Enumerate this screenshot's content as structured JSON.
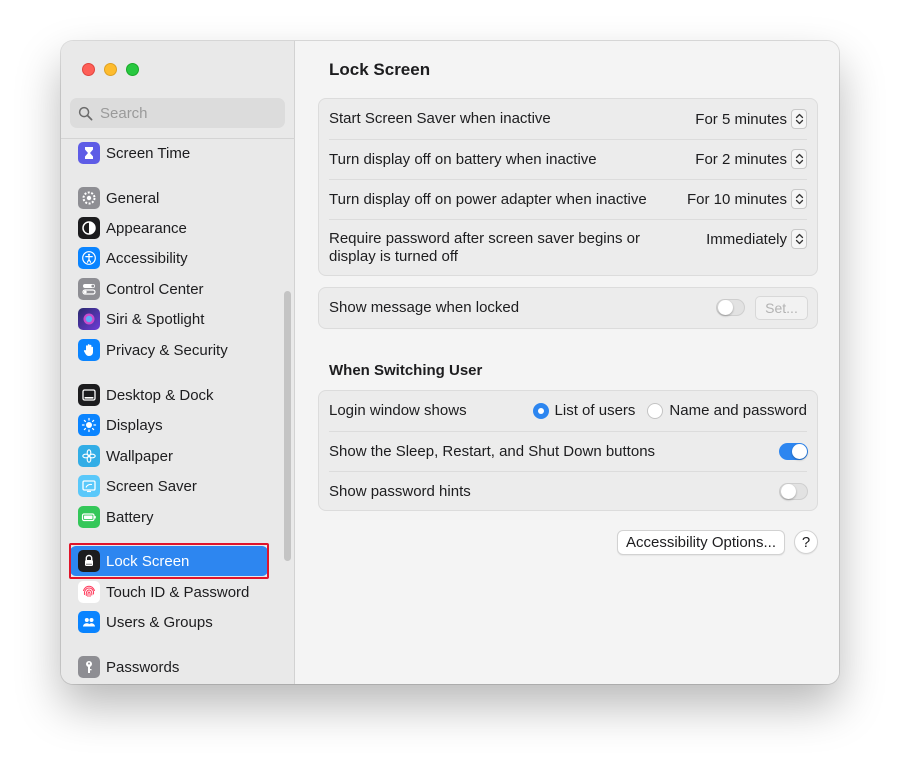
{
  "window": {
    "title": "Lock Screen"
  },
  "search": {
    "placeholder": "Search"
  },
  "sidebar": {
    "items": [
      {
        "label": "Screen Time",
        "icon": "hourglass-icon",
        "color": "#5e5ce6"
      },
      {
        "label": "General",
        "icon": "gear-icon",
        "color": "#8e8e93"
      },
      {
        "label": "Appearance",
        "icon": "appearance-icon",
        "color": "#1c1c1e"
      },
      {
        "label": "Accessibility",
        "icon": "accessibility-icon",
        "color": "#0a84ff"
      },
      {
        "label": "Control Center",
        "icon": "toggles-icon",
        "color": "#8e8e93"
      },
      {
        "label": "Siri & Spotlight",
        "icon": "siri-icon",
        "color": "#6e3bd8"
      },
      {
        "label": "Privacy & Security",
        "icon": "hand-icon",
        "color": "#0a84ff"
      },
      {
        "label": "Desktop & Dock",
        "icon": "dock-icon",
        "color": "#1c1c1e"
      },
      {
        "label": "Displays",
        "icon": "sun-icon",
        "color": "#0a84ff"
      },
      {
        "label": "Wallpaper",
        "icon": "flower-icon",
        "color": "#32ade6"
      },
      {
        "label": "Screen Saver",
        "icon": "screensaver-icon",
        "color": "#5ac8fa"
      },
      {
        "label": "Battery",
        "icon": "battery-icon",
        "color": "#34c759"
      },
      {
        "label": "Lock Screen",
        "icon": "lock-icon",
        "color": "#1c1c1e",
        "selected": true
      },
      {
        "label": "Touch ID & Password",
        "icon": "fingerprint-icon",
        "color": "#ff3b5c"
      },
      {
        "label": "Users & Groups",
        "icon": "users-icon",
        "color": "#0a84ff"
      },
      {
        "label": "Passwords",
        "icon": "key-icon",
        "color": "#8e8e93"
      }
    ]
  },
  "lock_settings": {
    "rows": [
      {
        "label": "Start Screen Saver when inactive",
        "value": "For 5 minutes"
      },
      {
        "label": "Turn display off on battery when inactive",
        "value": "For 2 minutes"
      },
      {
        "label": "Turn display off on power adapter when inactive",
        "value": "For 10 minutes"
      },
      {
        "label_line1": "Require password after screen saver begins or",
        "label_line2": "display is turned off",
        "value": "Immediately"
      }
    ]
  },
  "message_row": {
    "label": "Show message when locked",
    "toggle": "off",
    "button_label": "Set..."
  },
  "switching_user": {
    "title": "When Switching User",
    "login_window_label": "Login window shows",
    "option_list": "List of users",
    "option_name": "Name and password",
    "selected_option": "List of users",
    "shutdown_label": "Show the Sleep, Restart, and Shut Down buttons",
    "shutdown_toggle": "on",
    "hints_label": "Show password hints",
    "hints_toggle": "off"
  },
  "footer": {
    "accessibility_button": "Accessibility Options...",
    "help_button": "?"
  },
  "colors": {
    "accent": "#2d86f0",
    "highlight_outline": "#e0142a"
  }
}
